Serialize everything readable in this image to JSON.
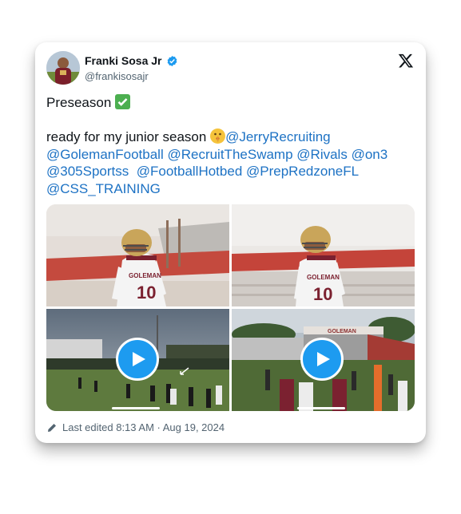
{
  "author": {
    "name": "Franki Sosa Jr",
    "handle": "@frankisosajr",
    "verified": true
  },
  "tweet": {
    "line1": "Preseason",
    "line2_prefix": "ready for my junior season",
    "mentions": [
      "@JerryRecruiting",
      "@GolemanFootball",
      "@RecruitTheSwamp",
      "@Rivals",
      "@on3",
      "@305Sportss",
      "@FootballHotbed",
      "@PrepRedzoneFL",
      "@CSS_TRAINING"
    ]
  },
  "media": {
    "photo1_jersey": "10",
    "photo2_jersey": "10",
    "jersey_text": "GOLEMAN",
    "stand_sign": "GOLEMAN",
    "video_count": 2
  },
  "footer": {
    "edited": "Last edited 8:13 AM · Aug 19, 2024"
  },
  "colors": {
    "link": "#1d72c4",
    "verified": "#1d9bf0",
    "play_button": "#1d9bf0",
    "check_emoji": "#4caf50"
  },
  "icons": [
    "verified-badge-icon",
    "x-logo-icon",
    "check-mark-emoji-icon",
    "shushing-face-emoji-icon",
    "play-icon",
    "pencil-icon"
  ]
}
